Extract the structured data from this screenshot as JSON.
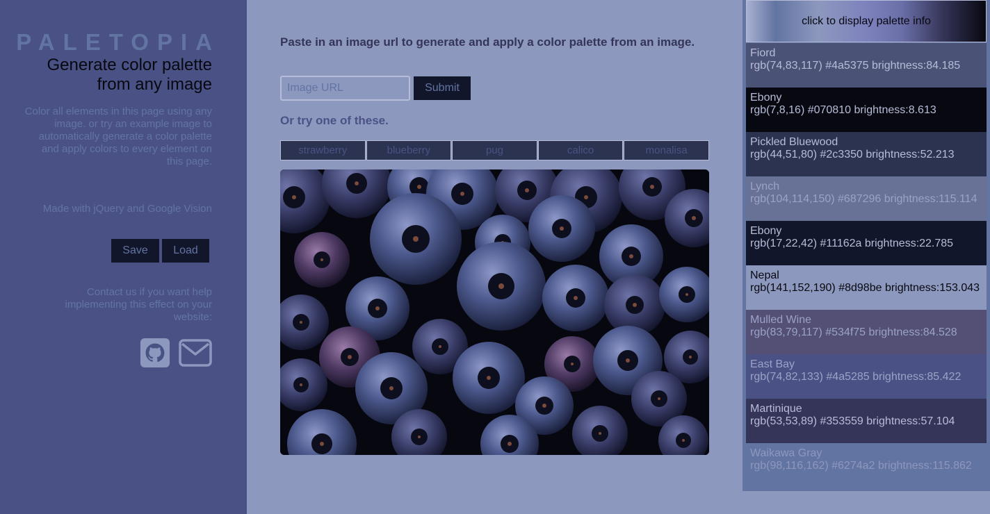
{
  "sidebar": {
    "brand": "PALETOPIA",
    "tagline": "Generate color palette from any image",
    "description": "Color all elements in this page using any image. or try an example image to automatically generate a color palette and apply colors to every element on this page.",
    "made_with": "Made with jQuery and Google Vision",
    "save_label": "Save",
    "load_label": "Load",
    "contact": "Contact us if you want help implementing this effect on your website:",
    "icons": [
      "github-icon",
      "mail-icon"
    ]
  },
  "main": {
    "heading": "Paste in an image url to generate and apply a color palette from an image.",
    "url_placeholder": "Image URL",
    "url_value": "",
    "submit_label": "Submit",
    "try_label": "Or try one of these.",
    "examples": [
      "strawberry",
      "blueberry",
      "pug",
      "calico",
      "monalisa"
    ],
    "image_subject": "blueberries"
  },
  "palette": {
    "header_label": "click to display palette info",
    "swatches": [
      {
        "name": "Fiord",
        "value": "rgb(74,83,117) #4a5375 brightness:84.185",
        "bg": "#4a5375",
        "fg": "#b7bdd8"
      },
      {
        "name": "Ebony",
        "value": "rgb(7,8,16) #070810 brightness:8.613",
        "bg": "#070810",
        "fg": "#b7bdd8"
      },
      {
        "name": "Pickled Bluewood",
        "value": "rgb(44,51,80) #2c3350 brightness:52.213",
        "bg": "#2c3350",
        "fg": "#b7bdd8"
      },
      {
        "name": "Lynch",
        "value": "rgb(104,114,150) #687296 brightness:115.114",
        "bg": "#687296",
        "fg": "#9aa3c6"
      },
      {
        "name": "Ebony",
        "value": "rgb(17,22,42) #11162a brightness:22.785",
        "bg": "#11162a",
        "fg": "#b7bdd8"
      },
      {
        "name": "Nepal",
        "value": "rgb(141,152,190) #8d98be brightness:153.043",
        "bg": "#8d98be",
        "fg": "#070810"
      },
      {
        "name": "Mulled Wine",
        "value": "rgb(83,79,117) #534f75 brightness:84.528",
        "bg": "#534f75",
        "fg": "#9aa3c6"
      },
      {
        "name": "East Bay",
        "value": "rgb(74,82,133) #4a5285 brightness:85.422",
        "bg": "#4a5285",
        "fg": "#9aa3c6"
      },
      {
        "name": "Martinique",
        "value": "rgb(53,53,89) #353559 brightness:57.104",
        "bg": "#353559",
        "fg": "#b7bdd8"
      },
      {
        "name": "Waikawa Gray",
        "value": "rgb(98,116,162) #6274a2 brightness:115.862",
        "bg": "#6274a2",
        "fg": "#8d98be"
      }
    ]
  }
}
